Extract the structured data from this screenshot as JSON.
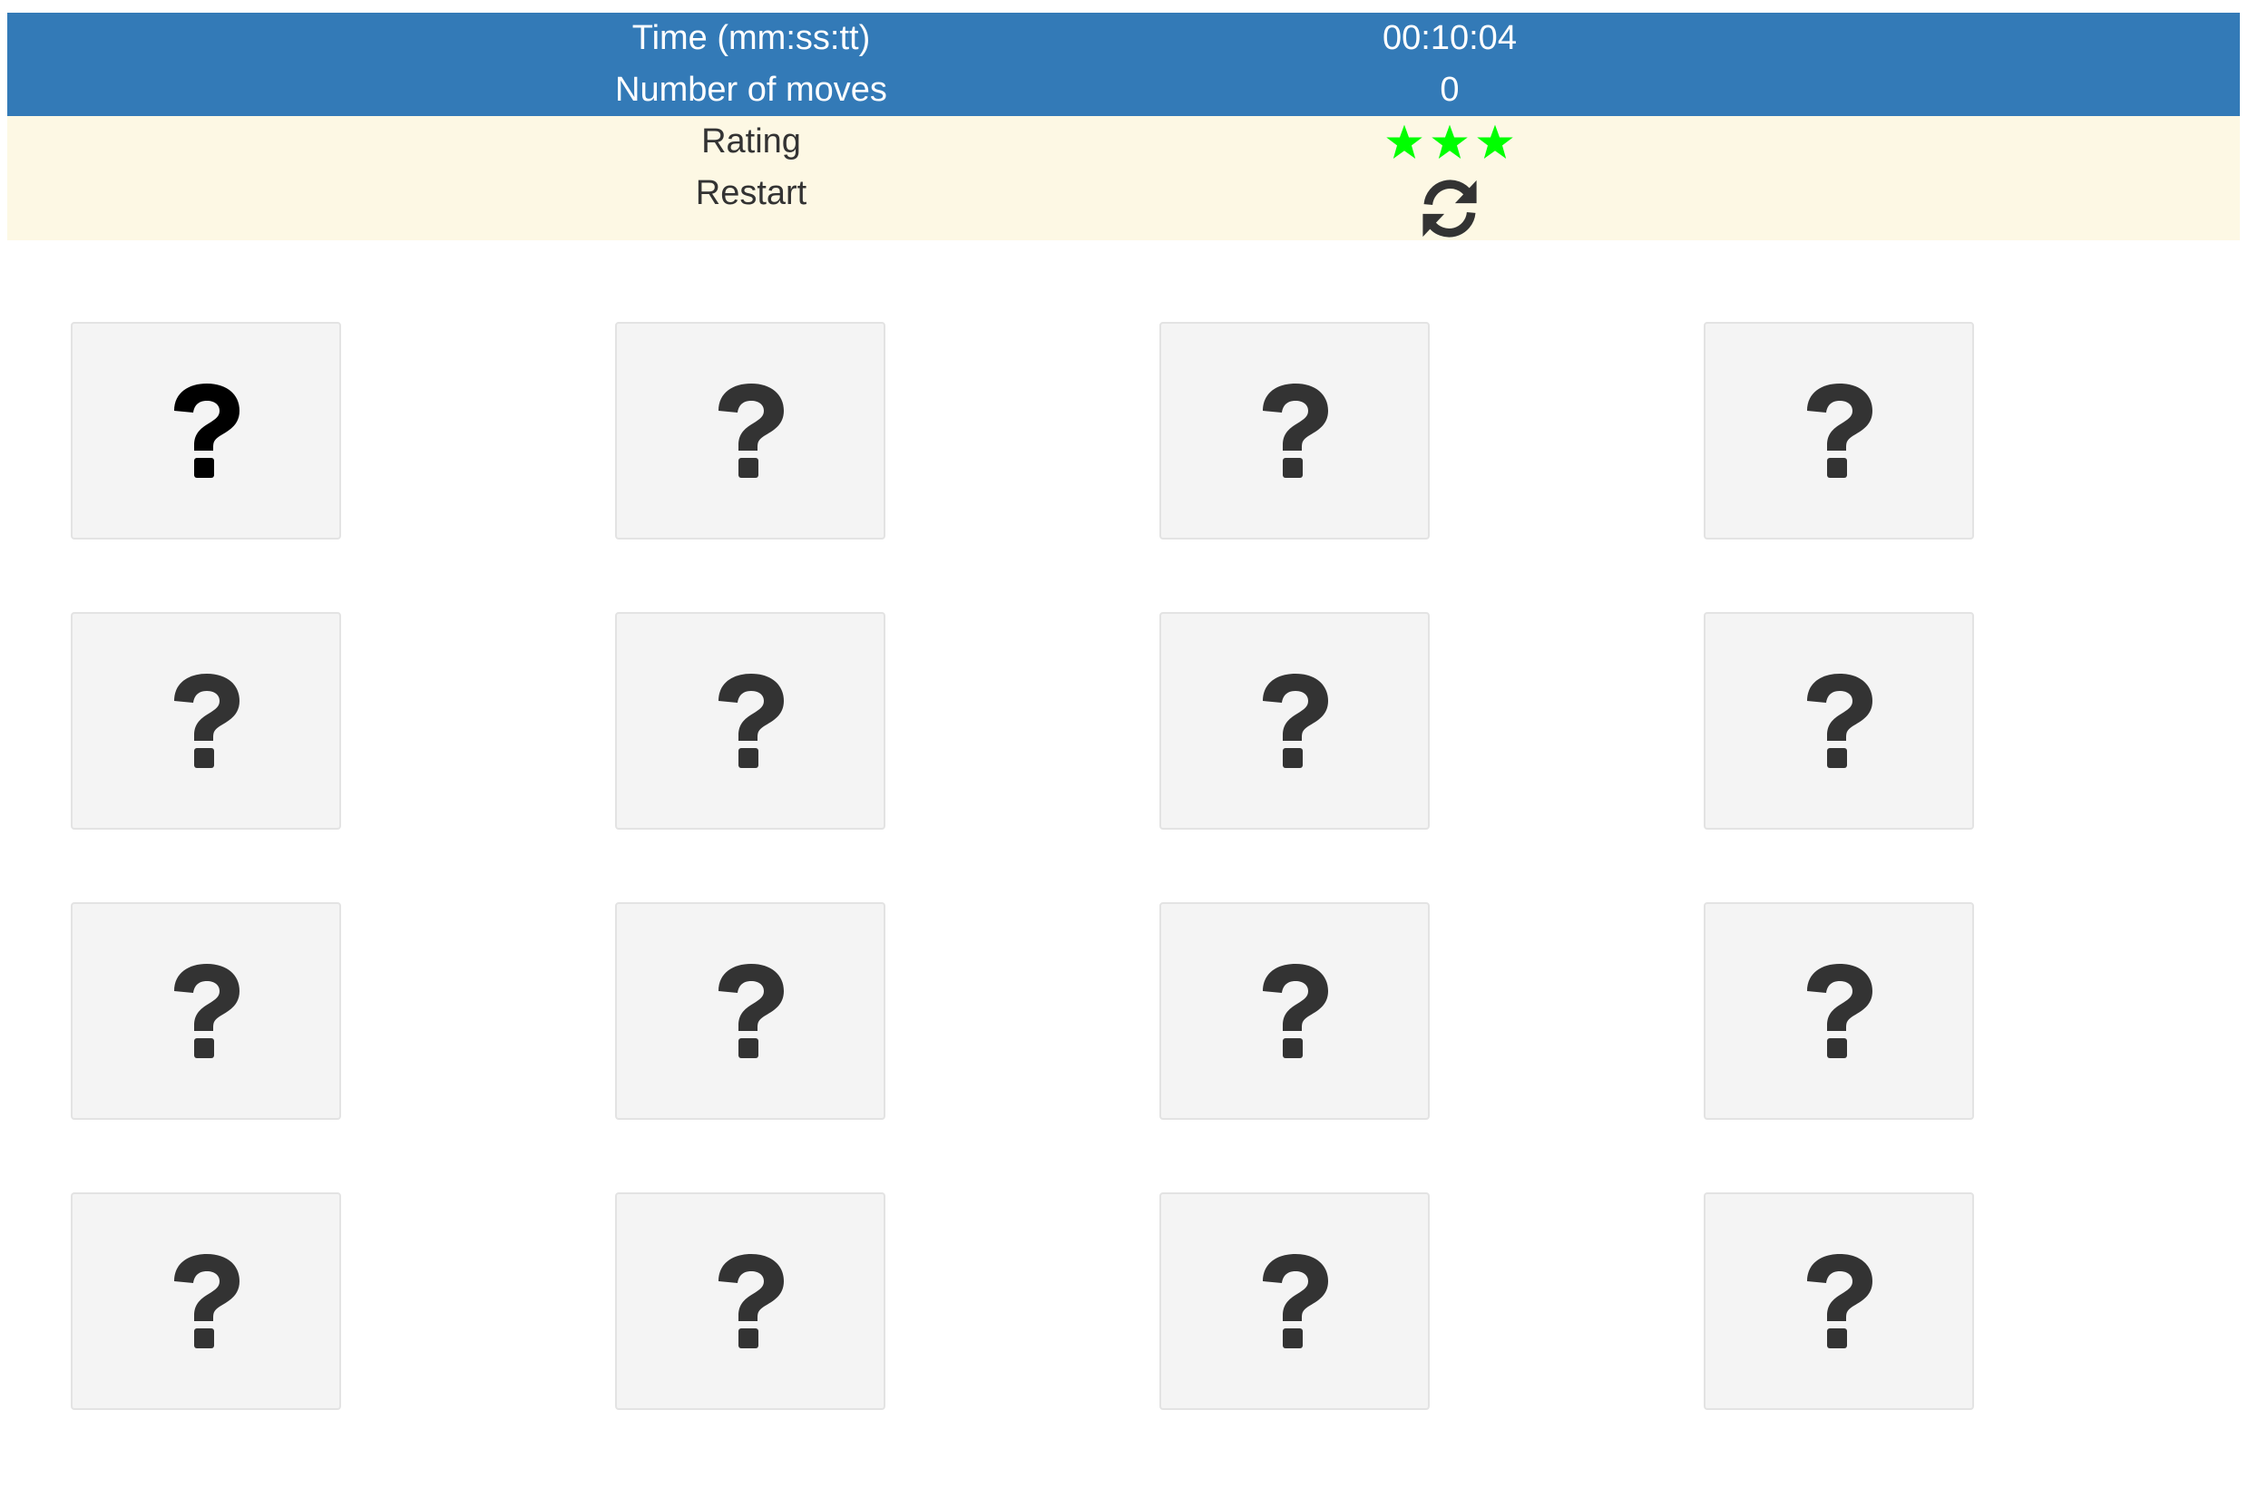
{
  "score": {
    "time_label": "Time (mm:ss:tt)",
    "time_value": "00:10:04",
    "moves_label": "Number of moves",
    "moves_value": "0",
    "rating_label": "Rating",
    "rating_stars": 3,
    "rating_max": 3,
    "restart_label": "Restart",
    "restart_icon": "refresh-icon"
  },
  "colors": {
    "header_blue": "#337ab7",
    "panel_cream": "#fdf8e4",
    "star_green": "#00ff00",
    "card_bg": "#f4f4f4",
    "icon_dark": "#333333"
  },
  "deck": {
    "rows": 4,
    "columns": 4,
    "card_icon": "question-mark-icon",
    "cards": [
      {
        "face": "hidden"
      },
      {
        "face": "hidden"
      },
      {
        "face": "hidden"
      },
      {
        "face": "hidden"
      },
      {
        "face": "hidden"
      },
      {
        "face": "hidden"
      },
      {
        "face": "hidden"
      },
      {
        "face": "hidden"
      },
      {
        "face": "hidden"
      },
      {
        "face": "hidden"
      },
      {
        "face": "hidden"
      },
      {
        "face": "hidden"
      },
      {
        "face": "hidden"
      },
      {
        "face": "hidden"
      },
      {
        "face": "hidden"
      },
      {
        "face": "hidden"
      }
    ]
  }
}
